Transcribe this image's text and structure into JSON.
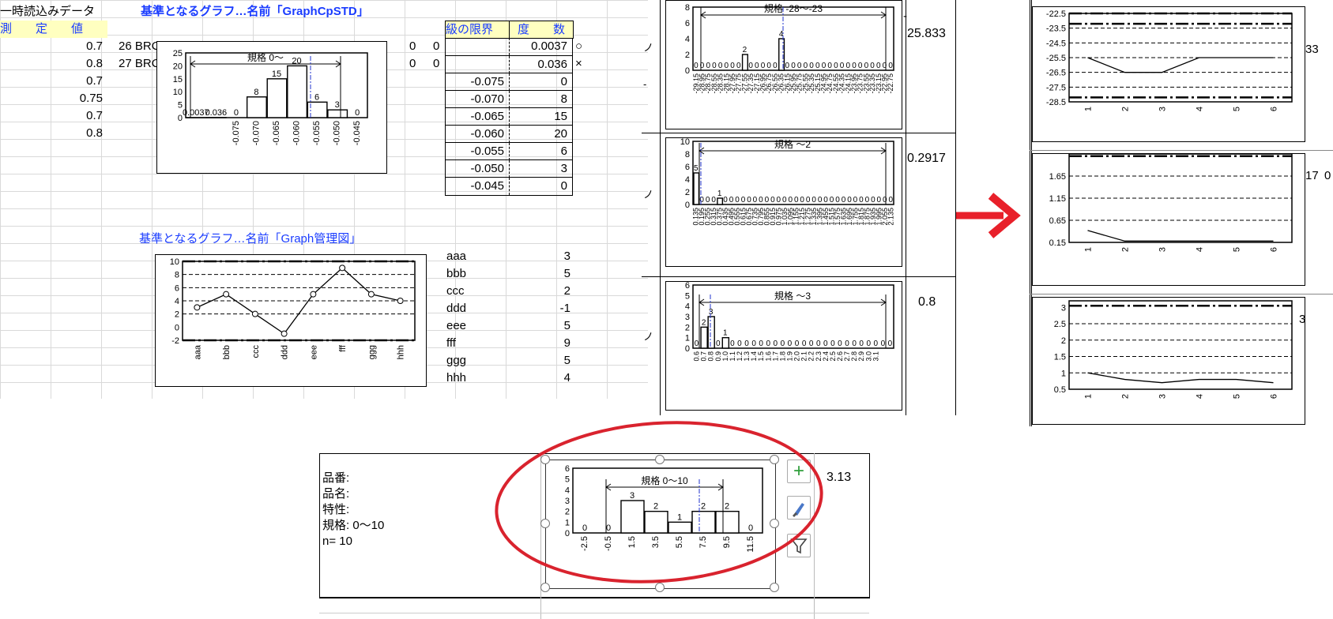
{
  "sheet": {
    "title_temp": "一時読込みデータ",
    "col_header": "測　　定　　値",
    "values": [
      "0.7",
      "0.8",
      "0.7",
      "0.75",
      "0.7",
      "0.8"
    ],
    "row_labels": [
      "26 BRC",
      "27 BRC"
    ],
    "zeros": [
      "0",
      "0",
      "0",
      "0"
    ],
    "graph1_title": "基準となるグラフ…名前「GraphCpSTD」",
    "graph2_title": "基準となるグラフ…名前「Graph管理図」",
    "marks": [
      "○",
      "×"
    ],
    "class_header": "級の限界",
    "freq_header": "度　　数",
    "class_rows": [
      {
        "limit": "",
        "count": "0.0037"
      },
      {
        "limit": "",
        "count": "0.036"
      },
      {
        "limit": "-0.075",
        "count": "0"
      },
      {
        "limit": "-0.070",
        "count": "8"
      },
      {
        "limit": "-0.065",
        "count": "15"
      },
      {
        "limit": "-0.060",
        "count": "20"
      },
      {
        "limit": "-0.055",
        "count": "6"
      },
      {
        "limit": "-0.050",
        "count": "3"
      },
      {
        "limit": "-0.045",
        "count": "0"
      }
    ],
    "ctrl_rows": [
      {
        "label": "aaa",
        "value": "3"
      },
      {
        "label": "bbb",
        "value": "5"
      },
      {
        "label": "ccc",
        "value": "2"
      },
      {
        "label": "ddd",
        "value": "-1"
      },
      {
        "label": "eee",
        "value": "5"
      },
      {
        "label": "fff",
        "value": "9"
      },
      {
        "label": "ggg",
        "value": "5"
      },
      {
        "label": "hhh",
        "value": "4"
      }
    ]
  },
  "panel_values": [
    "-",
    "25.833",
    "0.2917",
    "0.8"
  ],
  "right_values": [
    "33",
    "17",
    "0",
    "3"
  ],
  "arrow_color": "#e8202a",
  "ellipse_color": "#d9232e",
  "bottom": {
    "info": [
      "品番:",
      "品名:",
      "特性:",
      "規格: 0〜10",
      "n= 10"
    ],
    "value": "3.13",
    "tools": [
      "plus-icon",
      "brush-icon",
      "filter-icon"
    ]
  },
  "chart_data": [
    {
      "type": "bar",
      "id": "hist-std",
      "spec": "規格 0〜",
      "categories": [
        "",
        "",
        "-0.075",
        "-0.070",
        "-0.065",
        "-0.060",
        "-0.055",
        "-0.050",
        "-0.045"
      ],
      "labels": [
        "0.0037",
        "0.036",
        "0",
        "8",
        "15",
        "20",
        "6",
        "3",
        "0"
      ],
      "values": [
        0.0037,
        0.036,
        0,
        8,
        15,
        20,
        6,
        3,
        0
      ],
      "ylim": [
        0,
        25
      ],
      "yticks": [
        0,
        5,
        10,
        15,
        20,
        25
      ]
    },
    {
      "type": "line",
      "id": "ctrl",
      "categories": [
        "aaa",
        "bbb",
        "ccc",
        "ddd",
        "eee",
        "fff",
        "ggg",
        "hhh"
      ],
      "values": [
        3,
        5,
        2,
        -1,
        5,
        9,
        5,
        4
      ],
      "ylim": [
        -2,
        10
      ],
      "yticks": [
        -2,
        0,
        2,
        4,
        6,
        8,
        10
      ]
    },
    {
      "type": "bar",
      "id": "p1",
      "spec": "規格 -28〜-23",
      "ylim": [
        0,
        8
      ],
      "yticks": [
        0,
        2,
        4,
        6,
        8
      ],
      "values": [
        0,
        0,
        0,
        0,
        0,
        0,
        0,
        0,
        2,
        0,
        0,
        0,
        0,
        0,
        4,
        0,
        0,
        0,
        0,
        0,
        0,
        0,
        0,
        0,
        0,
        0,
        0,
        0,
        0,
        0,
        0,
        0,
        0
      ],
      "categories": [
        "-29.15",
        "-28.95",
        "-28.75",
        "-28.55",
        "-28.35",
        "-28.15",
        "-27.95",
        "-27.75",
        "-27.55",
        "-27.35",
        "-27.15",
        "-26.95",
        "-26.75",
        "-26.55",
        "-26.35",
        "-26.15",
        "-25.95",
        "-25.75",
        "-25.55",
        "-25.35",
        "-25.15",
        "-24.95",
        "-24.75",
        "-24.55",
        "-24.35",
        "-24.15",
        "-23.95",
        "-23.75",
        "-23.55",
        "-23.35",
        "-23.15",
        "-22.95",
        "-22.75"
      ]
    },
    {
      "type": "bar",
      "id": "p2",
      "spec": "規格 〜2",
      "ylim": [
        0,
        10
      ],
      "yticks": [
        0,
        2,
        4,
        6,
        8,
        10
      ],
      "values": [
        5,
        0,
        0,
        0,
        1,
        0,
        0,
        0,
        0,
        0,
        0,
        0,
        0,
        0,
        0,
        0,
        0,
        0,
        0,
        0,
        0,
        0,
        0,
        0,
        0,
        0,
        0,
        0,
        0,
        0,
        0,
        0,
        0,
        0
      ],
      "categories": [
        "0.135",
        "0.195",
        "0.255",
        "0.315",
        "0.375",
        "0.435",
        "0.495",
        "0.555",
        "0.615",
        "0.675",
        "0.735",
        "0.795",
        "0.855",
        "0.915",
        "0.975",
        "1.035",
        "1.095",
        "1.155",
        "1.215",
        "1.275",
        "1.335",
        "1.395",
        "1.455",
        "1.515",
        "1.575",
        "1.635",
        "1.695",
        "1.755",
        "1.815",
        "1.875",
        "1.935",
        "1.995",
        "2.055",
        "2.135"
      ]
    },
    {
      "type": "bar",
      "id": "p3",
      "spec": "規格 〜3",
      "ylim": [
        0,
        6
      ],
      "yticks": [
        0,
        1,
        2,
        3,
        4,
        5,
        6
      ],
      "values": [
        0,
        2,
        3,
        0,
        1,
        0,
        0,
        0,
        0,
        0,
        0,
        0,
        0,
        0,
        0,
        0,
        0,
        0,
        0,
        0,
        0,
        0,
        0,
        0,
        0,
        0,
        0,
        0
      ],
      "categories": [
        "0.6",
        "0.7",
        "0.8",
        "0.9",
        "1.0",
        "1.1",
        "1.2",
        "1.3",
        "1.4",
        "1.5",
        "1.6",
        "1.7",
        "1.8",
        "1.9",
        "2.0",
        "2.1",
        "2.2",
        "2.3",
        "2.4",
        "2.5",
        "2.6",
        "2.7",
        "2.8",
        "2.9",
        "3.0",
        "3.1",
        "",
        ""
      ]
    },
    {
      "type": "line",
      "id": "r1",
      "categories": [
        "1",
        "2",
        "3",
        "4",
        "5",
        "6"
      ],
      "values": [
        -25.5,
        -26.5,
        -26.5,
        -25.5,
        -25.5,
        -25.5
      ],
      "ylim": [
        -28.5,
        -22.5
      ],
      "yticks": [
        -22.5,
        -23.5,
        -24.5,
        -25.5,
        -26.5,
        -27.5,
        -28.5
      ]
    },
    {
      "type": "line",
      "id": "r2",
      "categories": [
        "1",
        "2",
        "3",
        "4",
        "5",
        "6"
      ],
      "values": [
        0.42,
        0.18,
        0.18,
        0.18,
        0.18,
        0.18
      ],
      "ylim": [
        0.15,
        2.15
      ],
      "yticks": [
        1.65,
        1.15,
        0.65,
        0.15
      ]
    },
    {
      "type": "line",
      "id": "r3",
      "categories": [
        "1",
        "2",
        "3",
        "4",
        "5",
        "6"
      ],
      "values": [
        1.0,
        0.8,
        0.7,
        0.8,
        0.8,
        0.7
      ],
      "ylim": [
        0.5,
        3.2
      ],
      "yticks": [
        3,
        2.5,
        2,
        1.5,
        1,
        0.5
      ]
    },
    {
      "type": "bar",
      "id": "bottom",
      "spec": "規格 0〜10",
      "ylim": [
        0,
        6
      ],
      "yticks": [
        0,
        1,
        2,
        3,
        4,
        5,
        6
      ],
      "categories": [
        "-2.5",
        "-0.5",
        "1.5",
        "3.5",
        "5.5",
        "7.5",
        "9.5",
        "11.5"
      ],
      "values": [
        0,
        0,
        3,
        2,
        1,
        2,
        2,
        0
      ]
    }
  ]
}
